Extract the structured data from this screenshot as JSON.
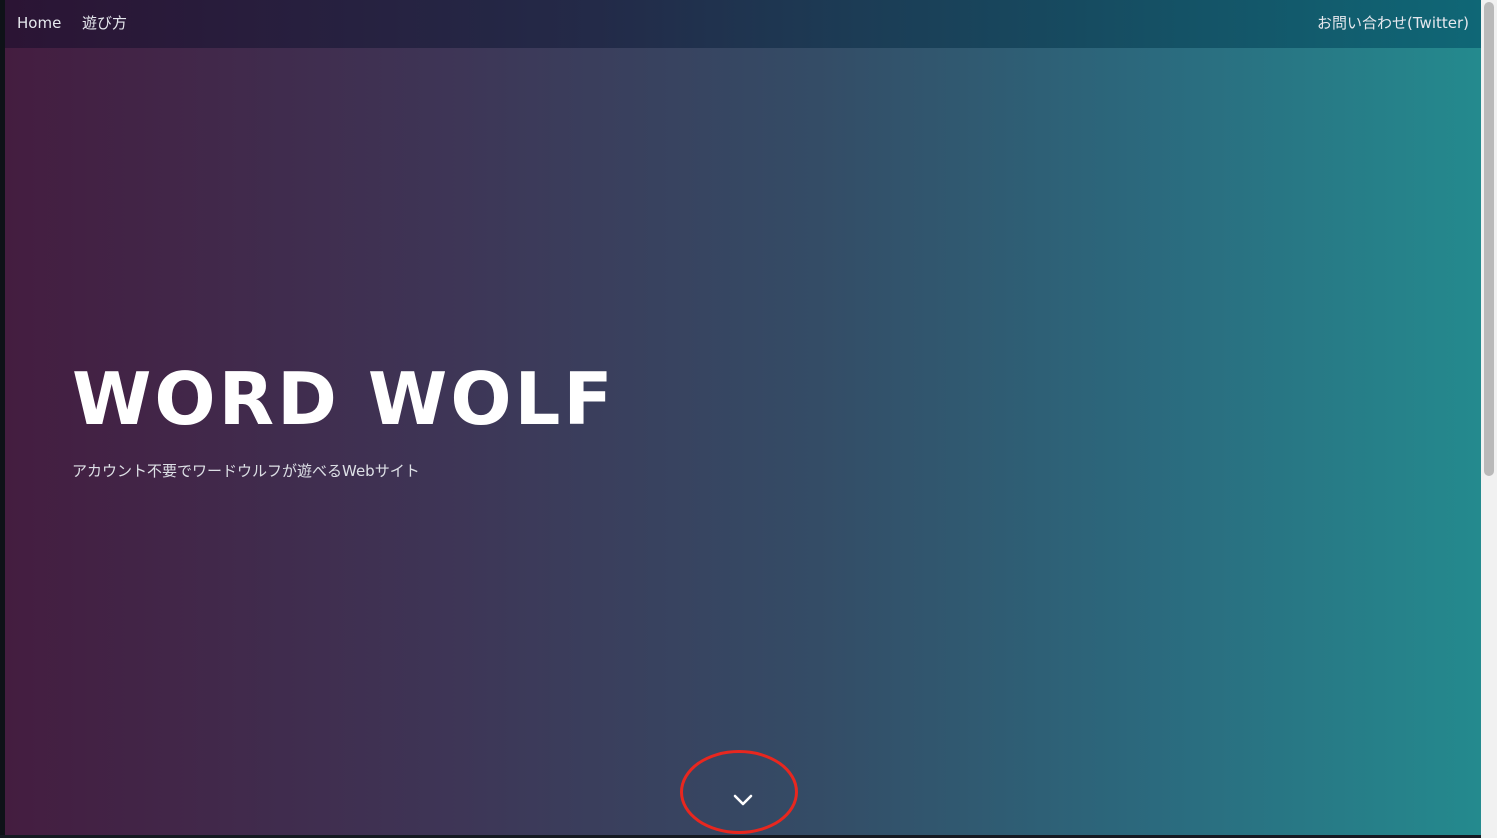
{
  "nav": {
    "home": "Home",
    "how_to_play": "遊び方",
    "contact": "お問い合わせ(Twitter)"
  },
  "hero": {
    "title": "WORD WOLF",
    "subtitle": "アカウント不要でワードウルフが遊べるWebサイト"
  },
  "scroll_down": {
    "icon": "chevron-down-icon"
  },
  "colors": {
    "gradient_start": "#441d40",
    "gradient_end": "#248a8e",
    "highlight_ring": "#e8271f",
    "text": "#ffffff"
  }
}
